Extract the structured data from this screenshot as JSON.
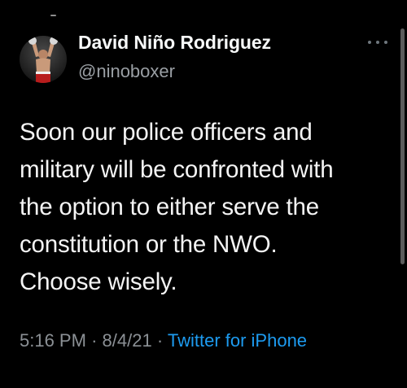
{
  "tweet": {
    "author_name": "David Niño Rodriguez",
    "author_handle": "@ninoboxer",
    "text_lines": [
      "Soon our police officers and",
      "military will be confronted with",
      "the option to either serve the",
      "constitution or the NWO.",
      "Choose wisely."
    ],
    "time": "5:16 PM",
    "date": "8/4/21",
    "separator": "·",
    "source": "Twitter for iPhone"
  },
  "icons": {
    "more": "more-horizontal-icon"
  },
  "colors": {
    "background": "#000000",
    "name": "#f7f9f9",
    "secondary_text": "#8b9095",
    "link": "#1d9bf0"
  }
}
